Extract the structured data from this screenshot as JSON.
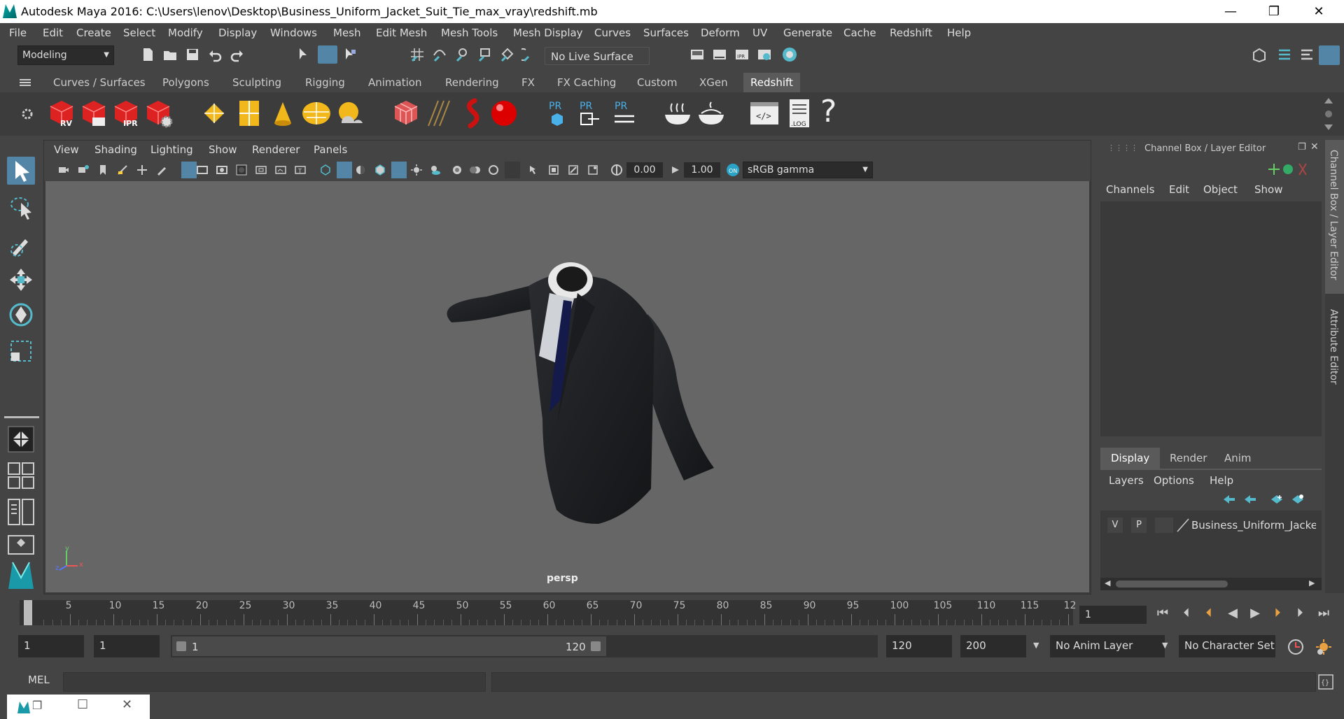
{
  "window": {
    "title": "Autodesk Maya 2016: C:\\Users\\lenov\\Desktop\\Business_Uniform_Jacket_Suit_Tie_max_vray\\redshift.mb",
    "minimize": "—",
    "maximize": "❐",
    "close": "✕"
  },
  "menubar": [
    "File",
    "Edit",
    "Create",
    "Select",
    "Modify",
    "Display",
    "Windows",
    "Mesh",
    "Edit Mesh",
    "Mesh Tools",
    "Mesh Display",
    "Curves",
    "Surfaces",
    "Deform",
    "UV",
    "Generate",
    "Cache",
    "Redshift",
    "Help"
  ],
  "status": {
    "mode": "Modeling",
    "live_surface": "No Live Surface"
  },
  "shelf_tabs": [
    "Curves / Surfaces",
    "Polygons",
    "Sculpting",
    "Rigging",
    "Animation",
    "Rendering",
    "FX",
    "FX Caching",
    "Custom",
    "XGen",
    "Redshift"
  ],
  "shelf_active": "Redshift",
  "shelf_icons": {
    "rv": "RV",
    "ipr": "IPR",
    "pr": "PR",
    "log": ".LOG",
    "help": "?"
  },
  "viewport": {
    "menus": [
      "View",
      "Shading",
      "Lighting",
      "Show",
      "Renderer",
      "Panels"
    ],
    "exposure": "0.00",
    "gamma": "1.00",
    "color_space": "sRGB gamma",
    "camera_label": "persp",
    "axis_x": "x",
    "axis_y": "y",
    "axis_z": "z"
  },
  "channel_box": {
    "title": "Channel Box / Layer Editor",
    "menus": [
      "Channels",
      "Edit",
      "Object",
      "Show"
    ],
    "layer_tabs": [
      "Display",
      "Render",
      "Anim"
    ],
    "layer_menus": [
      "Layers",
      "Options",
      "Help"
    ],
    "layer_row": {
      "v": "V",
      "p": "P",
      "name": "Business_Uniform_Jacket"
    }
  },
  "side_tabs": {
    "channel": "Channel Box / Layer Editor",
    "attribute": "Attribute Editor"
  },
  "timeline": {
    "ticks": [
      "1",
      "5",
      "10",
      "15",
      "20",
      "25",
      "30",
      "35",
      "40",
      "45",
      "50",
      "55",
      "60",
      "65",
      "70",
      "75",
      "80",
      "85",
      "90",
      "95",
      "100",
      "105",
      "110",
      "115",
      "12"
    ],
    "current_frame": "1"
  },
  "range": {
    "start": "1",
    "playback_start": "1",
    "slider_start": "1",
    "slider_end": "120",
    "playback_end": "120",
    "end": "200",
    "anim_layer": "No Anim Layer",
    "char_set": "No Character Set"
  },
  "cmdline": {
    "label": "MEL"
  }
}
